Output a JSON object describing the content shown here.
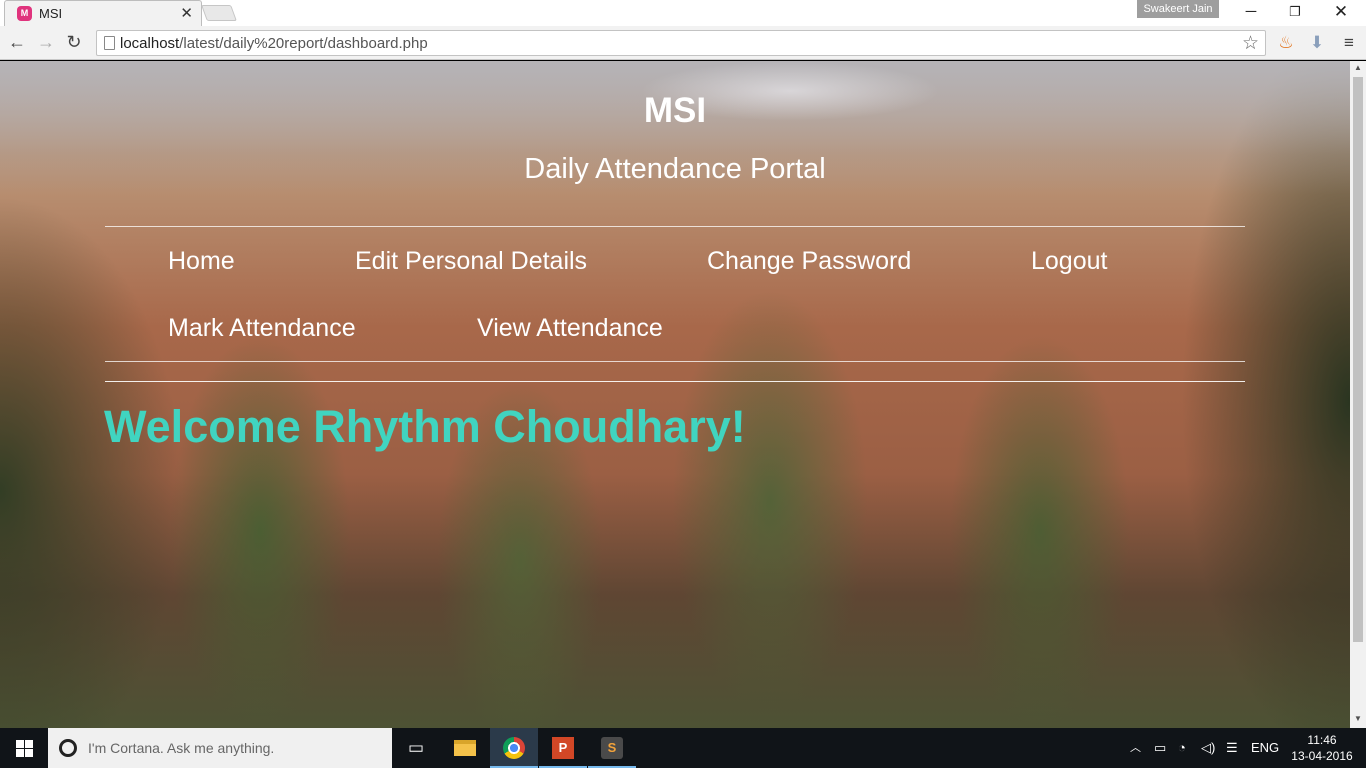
{
  "browser": {
    "tab_title": "MSI",
    "favicon_letter": "M",
    "user_name": "Swakeert Jain",
    "url_host": "localhost",
    "url_path": "/latest/daily%20report/dashboard.php"
  },
  "page": {
    "title": "MSI",
    "subtitle": "Daily Attendance Portal",
    "nav": {
      "home": "Home",
      "edit_personal_details": "Edit Personal Details",
      "change_password": "Change Password",
      "logout": "Logout",
      "mark_attendance": "Mark Attendance",
      "view_attendance": "View Attendance"
    },
    "welcome": "Welcome Rhythm Choudhary!",
    "welcome_color": "#40d4c0"
  },
  "taskbar": {
    "cortana_placeholder": "I'm Cortana. Ask me anything.",
    "language": "ENG",
    "time": "11:46",
    "date": "13-04-2016"
  },
  "icons": {
    "back": "back-arrow-icon",
    "forward": "forward-arrow-icon",
    "reload": "reload-icon",
    "star": "star-icon",
    "menu": "hamburger-menu-icon"
  }
}
